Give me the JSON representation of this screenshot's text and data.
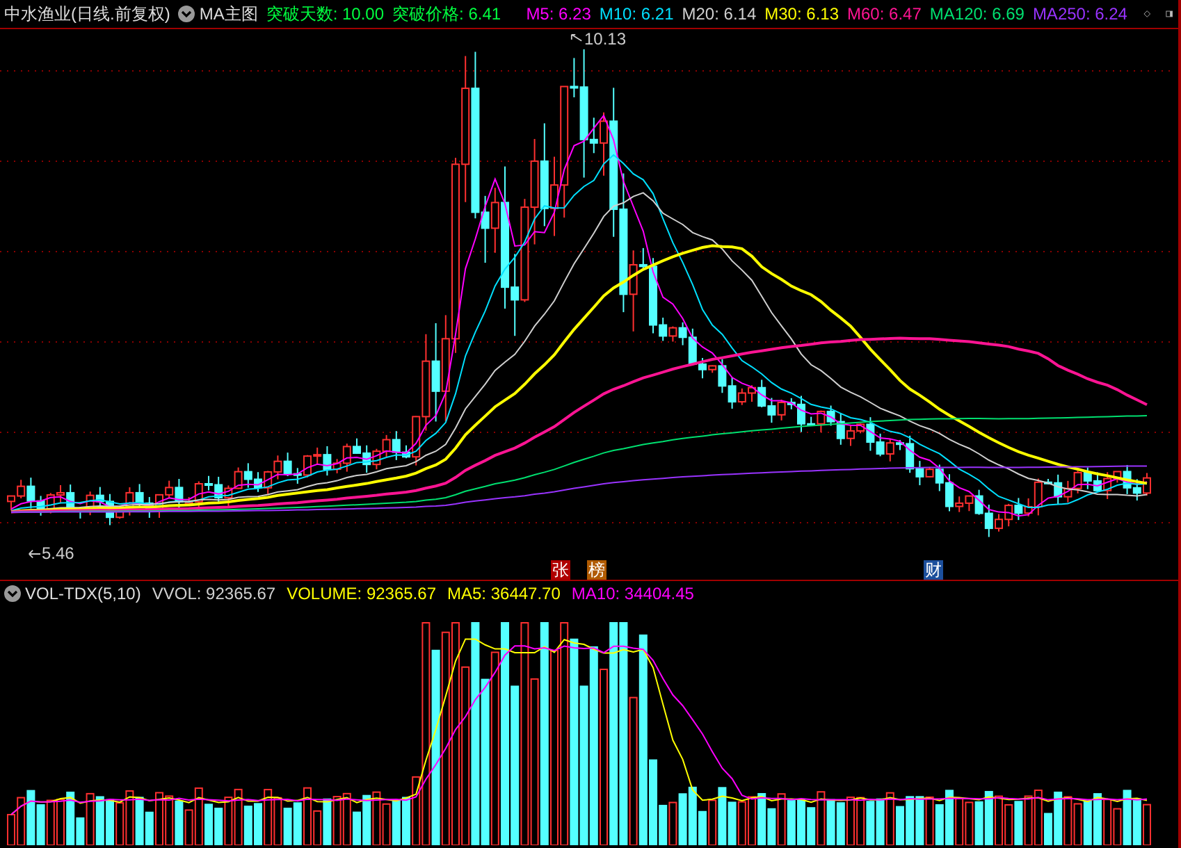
{
  "header": {
    "title": "中水渔业(日线.前复权)",
    "menu": "MA主图",
    "breakout": [
      {
        "text": "突破天数: 10.00"
      },
      {
        "text": "突破价格: 6.41"
      }
    ],
    "indicators": [
      {
        "text": "M5: 6.23",
        "color": "#ff00ff"
      },
      {
        "text": "M10: 6.21",
        "color": "#00e0ff"
      },
      {
        "text": "M20: 6.14",
        "color": "#d0d0d0"
      },
      {
        "text": "M30: 6.13",
        "color": "#ffff00"
      },
      {
        "text": "M60: 6.47",
        "color": "#ff1493"
      },
      {
        "text": "MA120: 6.69",
        "color": "#00e070"
      },
      {
        "text": "MA250: 6.24",
        "color": "#9933ff"
      }
    ]
  },
  "price_chart": {
    "high_label": "10.13",
    "low_label": "5.46",
    "badges": [
      {
        "text": "张",
        "color": "#b00000"
      },
      {
        "text": "榜",
        "color": "#b05a00"
      },
      {
        "text": "财",
        "color": "#1c4f9c"
      }
    ]
  },
  "volume_panel": {
    "indicator": "VOL-TDX(5,10)",
    "readings": [
      {
        "text": "VVOL: 92365.67",
        "color": "#d0d0d0"
      },
      {
        "text": "VOLUME: 92365.67",
        "color": "#ffff00"
      },
      {
        "text": "MA5: 36447.70",
        "color": "#ffff00"
      },
      {
        "text": "MA10: 34404.45",
        "color": "#ff00ff"
      }
    ]
  }
}
